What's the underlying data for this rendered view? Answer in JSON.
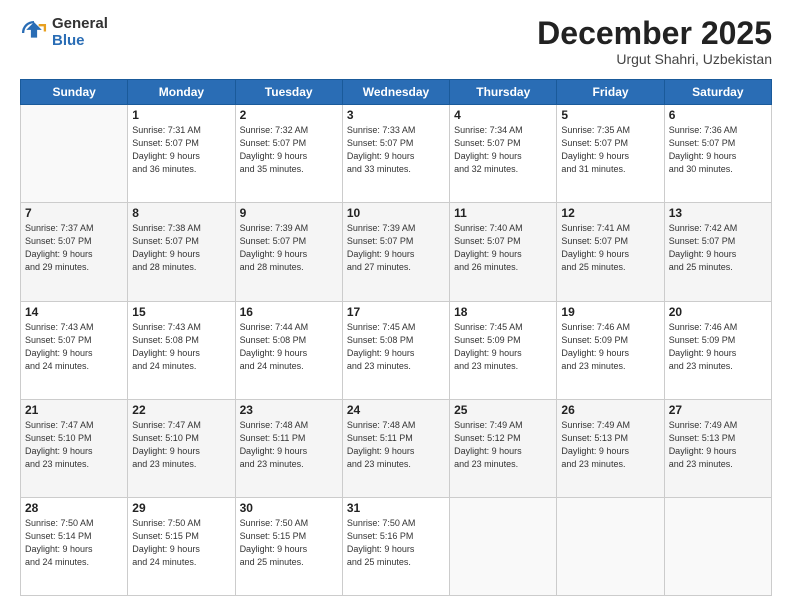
{
  "logo": {
    "general": "General",
    "blue": "Blue"
  },
  "header": {
    "month": "December 2025",
    "location": "Urgut Shahri, Uzbekistan"
  },
  "days_of_week": [
    "Sunday",
    "Monday",
    "Tuesday",
    "Wednesday",
    "Thursday",
    "Friday",
    "Saturday"
  ],
  "weeks": [
    [
      {
        "day": "",
        "info": ""
      },
      {
        "day": "1",
        "info": "Sunrise: 7:31 AM\nSunset: 5:07 PM\nDaylight: 9 hours\nand 36 minutes."
      },
      {
        "day": "2",
        "info": "Sunrise: 7:32 AM\nSunset: 5:07 PM\nDaylight: 9 hours\nand 35 minutes."
      },
      {
        "day": "3",
        "info": "Sunrise: 7:33 AM\nSunset: 5:07 PM\nDaylight: 9 hours\nand 33 minutes."
      },
      {
        "day": "4",
        "info": "Sunrise: 7:34 AM\nSunset: 5:07 PM\nDaylight: 9 hours\nand 32 minutes."
      },
      {
        "day": "5",
        "info": "Sunrise: 7:35 AM\nSunset: 5:07 PM\nDaylight: 9 hours\nand 31 minutes."
      },
      {
        "day": "6",
        "info": "Sunrise: 7:36 AM\nSunset: 5:07 PM\nDaylight: 9 hours\nand 30 minutes."
      }
    ],
    [
      {
        "day": "7",
        "info": "Sunrise: 7:37 AM\nSunset: 5:07 PM\nDaylight: 9 hours\nand 29 minutes."
      },
      {
        "day": "8",
        "info": "Sunrise: 7:38 AM\nSunset: 5:07 PM\nDaylight: 9 hours\nand 28 minutes."
      },
      {
        "day": "9",
        "info": "Sunrise: 7:39 AM\nSunset: 5:07 PM\nDaylight: 9 hours\nand 28 minutes."
      },
      {
        "day": "10",
        "info": "Sunrise: 7:39 AM\nSunset: 5:07 PM\nDaylight: 9 hours\nand 27 minutes."
      },
      {
        "day": "11",
        "info": "Sunrise: 7:40 AM\nSunset: 5:07 PM\nDaylight: 9 hours\nand 26 minutes."
      },
      {
        "day": "12",
        "info": "Sunrise: 7:41 AM\nSunset: 5:07 PM\nDaylight: 9 hours\nand 25 minutes."
      },
      {
        "day": "13",
        "info": "Sunrise: 7:42 AM\nSunset: 5:07 PM\nDaylight: 9 hours\nand 25 minutes."
      }
    ],
    [
      {
        "day": "14",
        "info": "Sunrise: 7:43 AM\nSunset: 5:07 PM\nDaylight: 9 hours\nand 24 minutes."
      },
      {
        "day": "15",
        "info": "Sunrise: 7:43 AM\nSunset: 5:08 PM\nDaylight: 9 hours\nand 24 minutes."
      },
      {
        "day": "16",
        "info": "Sunrise: 7:44 AM\nSunset: 5:08 PM\nDaylight: 9 hours\nand 24 minutes."
      },
      {
        "day": "17",
        "info": "Sunrise: 7:45 AM\nSunset: 5:08 PM\nDaylight: 9 hours\nand 23 minutes."
      },
      {
        "day": "18",
        "info": "Sunrise: 7:45 AM\nSunset: 5:09 PM\nDaylight: 9 hours\nand 23 minutes."
      },
      {
        "day": "19",
        "info": "Sunrise: 7:46 AM\nSunset: 5:09 PM\nDaylight: 9 hours\nand 23 minutes."
      },
      {
        "day": "20",
        "info": "Sunrise: 7:46 AM\nSunset: 5:09 PM\nDaylight: 9 hours\nand 23 minutes."
      }
    ],
    [
      {
        "day": "21",
        "info": "Sunrise: 7:47 AM\nSunset: 5:10 PM\nDaylight: 9 hours\nand 23 minutes."
      },
      {
        "day": "22",
        "info": "Sunrise: 7:47 AM\nSunset: 5:10 PM\nDaylight: 9 hours\nand 23 minutes."
      },
      {
        "day": "23",
        "info": "Sunrise: 7:48 AM\nSunset: 5:11 PM\nDaylight: 9 hours\nand 23 minutes."
      },
      {
        "day": "24",
        "info": "Sunrise: 7:48 AM\nSunset: 5:11 PM\nDaylight: 9 hours\nand 23 minutes."
      },
      {
        "day": "25",
        "info": "Sunrise: 7:49 AM\nSunset: 5:12 PM\nDaylight: 9 hours\nand 23 minutes."
      },
      {
        "day": "26",
        "info": "Sunrise: 7:49 AM\nSunset: 5:13 PM\nDaylight: 9 hours\nand 23 minutes."
      },
      {
        "day": "27",
        "info": "Sunrise: 7:49 AM\nSunset: 5:13 PM\nDaylight: 9 hours\nand 23 minutes."
      }
    ],
    [
      {
        "day": "28",
        "info": "Sunrise: 7:50 AM\nSunset: 5:14 PM\nDaylight: 9 hours\nand 24 minutes."
      },
      {
        "day": "29",
        "info": "Sunrise: 7:50 AM\nSunset: 5:15 PM\nDaylight: 9 hours\nand 24 minutes."
      },
      {
        "day": "30",
        "info": "Sunrise: 7:50 AM\nSunset: 5:15 PM\nDaylight: 9 hours\nand 25 minutes."
      },
      {
        "day": "31",
        "info": "Sunrise: 7:50 AM\nSunset: 5:16 PM\nDaylight: 9 hours\nand 25 minutes."
      },
      {
        "day": "",
        "info": ""
      },
      {
        "day": "",
        "info": ""
      },
      {
        "day": "",
        "info": ""
      }
    ]
  ]
}
